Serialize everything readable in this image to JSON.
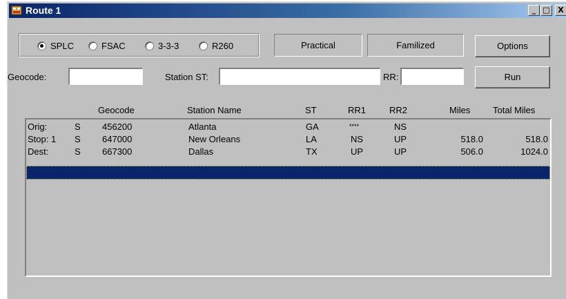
{
  "window": {
    "title": "Route 1",
    "min_label": "_",
    "max_label": "□",
    "close_label": "X"
  },
  "radios": [
    {
      "label": "SPLC",
      "selected": true
    },
    {
      "label": "FSAC",
      "selected": false
    },
    {
      "label": "3-3-3",
      "selected": false
    },
    {
      "label": "R260",
      "selected": false
    }
  ],
  "toolbar": {
    "practical_label": "Practical",
    "familized_label": "Familized",
    "options_label": "Options",
    "run_label": "Run"
  },
  "fields": {
    "geocode_label": "Geocode:",
    "geocode_value": "",
    "station_label": "Station ST:",
    "station_value": "",
    "rr_label": "RR:",
    "rr_value": ""
  },
  "columns": {
    "geocode": "Geocode",
    "station_name": "Station Name",
    "st": "ST",
    "rr1": "RR1",
    "rr2": "RR2",
    "miles": "Miles",
    "total_miles": "Total Miles"
  },
  "rows": [
    {
      "type": "Orig:",
      "flag": "S",
      "geocode": "456200",
      "station": "Atlanta",
      "st": "GA",
      "rr1": "****",
      "rr2": "NS",
      "miles": "",
      "total": ""
    },
    {
      "type": "Stop: 1",
      "flag": "S",
      "geocode": "647000",
      "station": "New Orleans",
      "st": "LA",
      "rr1": "NS",
      "rr2": "UP",
      "miles": "518.0",
      "total": "518.0"
    },
    {
      "type": "Dest:",
      "flag": "S",
      "geocode": "667300",
      "station": "Dallas",
      "st": "TX",
      "rr1": "UP",
      "rr2": "UP",
      "miles": "506.0",
      "total": "1024.0"
    }
  ]
}
